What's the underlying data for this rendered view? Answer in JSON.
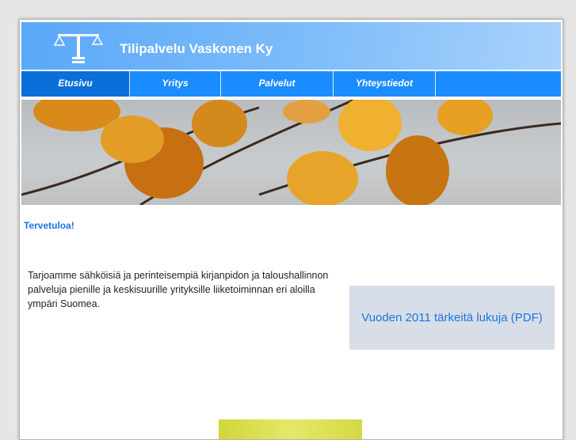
{
  "header": {
    "title": "Tilipalvelu Vaskonen Ky",
    "logo_icon": "scales-icon"
  },
  "nav": {
    "items": [
      {
        "label": "Etusivu",
        "active": true
      },
      {
        "label": "Yritys"
      },
      {
        "label": "Palvelut"
      },
      {
        "label": "Yhteystiedot"
      }
    ]
  },
  "main": {
    "welcome": "Tervetuloa!",
    "intro": "Tarjoamme sähköisiä ja perinteisempiä kirjanpidon ja taloushallinnon palveluja pienille ja keskisuurille yrityksille liiketoiminnan eri aloilla ympäri Suomea.",
    "pdf_link": "Vuoden 2011 tärkeitä lukuja (PDF)"
  },
  "colors": {
    "header": "#5aa8f8",
    "nav": "#1a8cff",
    "nav_active": "#0a6fd8",
    "link": "#1a74e0",
    "pdf_box": "#d8dee8"
  }
}
